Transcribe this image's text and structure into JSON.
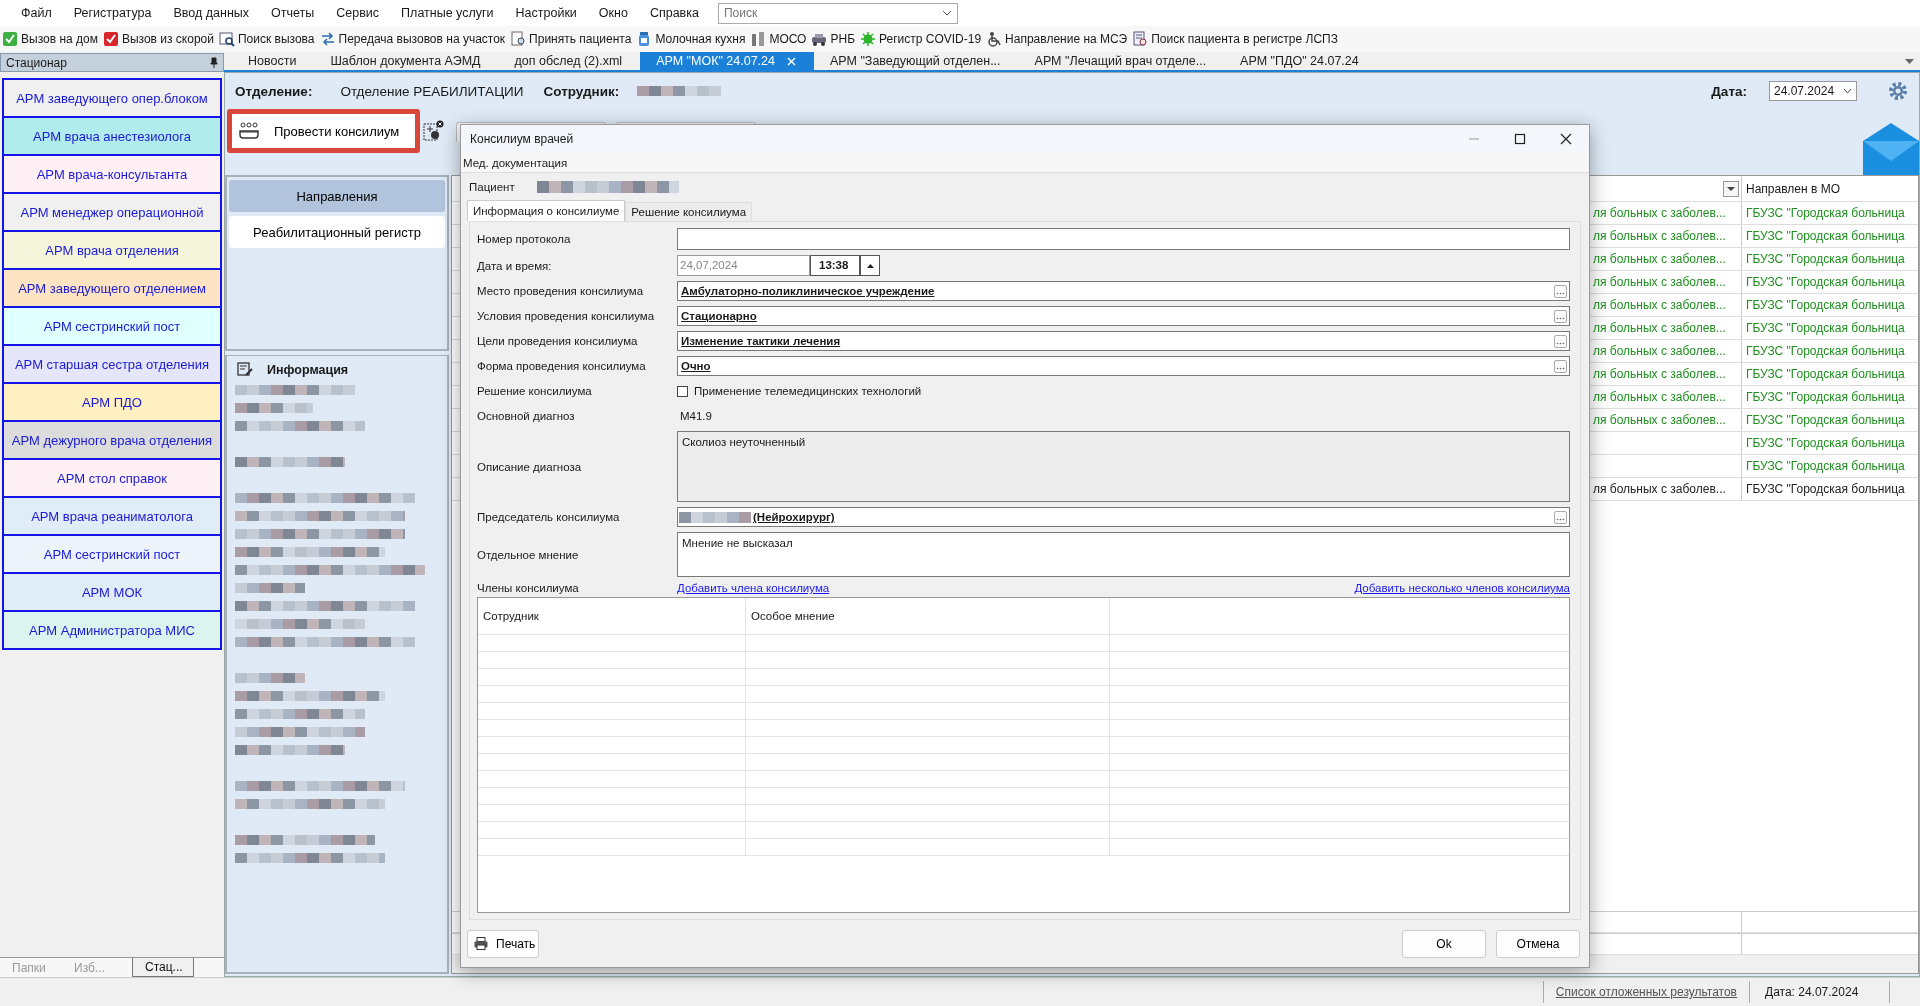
{
  "menu": [
    "Файл",
    "Регистратура",
    "Ввод данных",
    "Отчеты",
    "Сервис",
    "Платные услуги",
    "Настройки",
    "Окно",
    "Справка"
  ],
  "search": {
    "placeholder": "Поиск"
  },
  "toolbar": [
    {
      "label": "Вызов на дом"
    },
    {
      "label": "Вызов из скорой"
    },
    {
      "label": "Поиск вызова"
    },
    {
      "label": "Передача вызовов на участок"
    },
    {
      "label": "Принять пациента"
    },
    {
      "label": "Молочная кухня"
    },
    {
      "label": "МОСО"
    },
    {
      "label": "РНБ"
    },
    {
      "label": "Регистр COVID-19"
    },
    {
      "label": "Направление на МСЭ"
    },
    {
      "label": "Поиск пациента в регистре ЛСПЗ"
    }
  ],
  "sidebar": {
    "title": "Стационар",
    "items": [
      {
        "label": "АРМ заведующего опер.блоком",
        "color": "#f0f0f0"
      },
      {
        "label": "АРМ врача анестезиолога",
        "color": "#b0ecec"
      },
      {
        "label": "АРМ врача-консультанта",
        "color": "#fff0f5"
      },
      {
        "label": "АРМ менеджер  операционной",
        "color": "#f0f0f0"
      },
      {
        "label": "АРМ врача отделения",
        "color": "#f5f5dc"
      },
      {
        "label": "АРМ заведующего отделением",
        "color": "#ffe4c4"
      },
      {
        "label": "АРМ сестринский пост",
        "color": "#e0ffff"
      },
      {
        "label": "АРМ старшая сестра отделения",
        "color": "#e6e6fa"
      },
      {
        "label": "АРМ ПДО",
        "color": "#fff0c2"
      },
      {
        "label": "АРМ дежурного врача отделения",
        "color": "#dcdcdc"
      },
      {
        "label": "АРМ стол справок",
        "color": "#fff0f5"
      },
      {
        "label": "АРМ врача реаниматолога",
        "color": "#e0ecf8"
      },
      {
        "label": "АРМ сестринский пост",
        "color": "#ecf3fb"
      },
      {
        "label": "АРМ МОК",
        "color": "#e0ecf8"
      },
      {
        "label": "АРМ Администратора МИС",
        "color": "#dcf4ef"
      }
    ],
    "bottom_tabs": [
      {
        "label": "Папки",
        "selected": false
      },
      {
        "label": "Изб...",
        "selected": false
      },
      {
        "label": "Стац...",
        "selected": true
      }
    ]
  },
  "doc_tabs": [
    {
      "label": "Новости",
      "selected": false
    },
    {
      "label": "Шаблон документа АЭМД",
      "selected": false
    },
    {
      "label": "доп обслед (2).xml",
      "selected": false
    },
    {
      "label": "АРМ \"МОК\" 24.07.24",
      "selected": true
    },
    {
      "label": "АРМ \"Заведующий отделен...",
      "selected": false
    },
    {
      "label": "АРМ \"Лечащий врач отделе...",
      "selected": false
    },
    {
      "label": "АРМ \"ПДО\" 24.07.24",
      "selected": false
    }
  ],
  "header": {
    "department_label": "Отделение:",
    "department": "Отделение РЕАБИЛИТАЦИИ",
    "employee_label": "Сотрудник:",
    "date_label": "Дата:",
    "date": "24.07.2024"
  },
  "action_button": {
    "label": "Провести консилиум",
    "highlighted": true
  },
  "left_panel": {
    "items": [
      {
        "label": "Направления",
        "selected": true
      },
      {
        "label": "Реабилитационный регистр",
        "selected": false
      }
    ],
    "info_title": "Информация"
  },
  "table": {
    "columns": [
      {
        "filter": true
      },
      {
        "label": "Направлен в МО",
        "filter": false
      }
    ],
    "rows": [
      {
        "column_1": "ля больных с заболев...",
        "column_2": "ГБУЗС \"Городская больница",
        "color": "#1f8f1f"
      },
      {
        "column_1": "ля больных с заболев...",
        "column_2": "ГБУЗС \"Городская больница",
        "color": "#1f8f1f"
      },
      {
        "column_1": "ля больных с заболев...",
        "column_2": "ГБУЗС \"Городская больница",
        "color": "#1f8f1f"
      },
      {
        "column_1": "ля больных с заболев...",
        "column_2": "ГБУЗС \"Городская больница",
        "color": "#1f8f1f"
      },
      {
        "column_1": "ля больных с заболев...",
        "column_2": "ГБУЗС \"Городская больница",
        "color": "#1f8f1f"
      },
      {
        "column_1": "ля больных с заболев...",
        "column_2": "ГБУЗС \"Городская больница",
        "color": "#1f8f1f"
      },
      {
        "column_1": "ля больных с заболев...",
        "column_2": "ГБУЗС \"Городская больница",
        "color": "#1f8f1f"
      },
      {
        "column_1": "ля больных с заболев...",
        "column_2": "ГБУЗС \"Городская больница",
        "color": "#1f8f1f"
      },
      {
        "column_1": "ля больных с заболев...",
        "column_2": "ГБУЗС \"Городская больница",
        "color": "#1f8f1f"
      },
      {
        "column_1": "ля больных с заболев...",
        "column_2": "ГБУЗС \"Городская больница",
        "color": "#1f8f1f"
      },
      {
        "column_2": "ГБУЗС \"Городская больница",
        "color": "#1f8f1f"
      },
      {
        "column_2": "ГБУЗС \"Городская больница",
        "color": "#1f8f1f"
      },
      {
        "column_1": "ля больных с заболев...",
        "column_2": "ГБУЗС \"Городская больница",
        "color": "#222222"
      }
    ]
  },
  "dialog": {
    "title": "Консилиум врачей",
    "menu": [
      "Мед. документация"
    ],
    "patient_label": "Пациент",
    "tabs": [
      {
        "label": "Информация о консилиуме",
        "selected": true
      },
      {
        "label": "Решение консилиума",
        "selected": false
      }
    ],
    "fields": [
      {
        "kind": "input",
        "label": "Номер протокола"
      },
      {
        "kind": "datetime",
        "label": "Дата и время:",
        "date": "24,07,2024",
        "time": "13:38"
      },
      {
        "kind": "lookup",
        "label": "Место проведения консилиума",
        "value": "Амбулаторно-поликлиническое учреждение"
      },
      {
        "kind": "lookup",
        "label": "Условия проведения консилиума",
        "value": "Стационарно"
      },
      {
        "kind": "lookup",
        "label": "Цели проведения консилиума",
        "value": "Изменение тактики лечения"
      },
      {
        "kind": "lookup",
        "label": "Форма проведения консилиума",
        "value": "Очно"
      },
      {
        "kind": "checkbox",
        "label": "Решение консилиума",
        "text": "Применение телемедицинских технологий",
        "checked": false
      },
      {
        "kind": "static",
        "label": "Основной диагноз",
        "value": "M41.9"
      },
      {
        "kind": "textarea",
        "label": "Описание диагноза",
        "value": "Сколиоз неуточненный",
        "readonly": true
      },
      {
        "kind": "person",
        "label": "Председатель консилиума",
        "value": "(Нейрохирург)"
      },
      {
        "kind": "textarea",
        "label": "Отдельное мнение",
        "value": "Мнение не высказал",
        "readonly": false
      }
    ],
    "members": {
      "label": "Члены консилиума",
      "add_link": "Добавить члена консилиума",
      "add_many_link": "Добавить несколько членов консилиума",
      "columns": [
        "Сотрудник",
        "Особое мнение"
      ]
    },
    "buttons": {
      "print": "Печать",
      "ok": "Ok",
      "cancel": "Отмена"
    }
  },
  "status_bar": {
    "link": "Список отложенных результатов",
    "date": "Дата: 24.07.2024"
  }
}
